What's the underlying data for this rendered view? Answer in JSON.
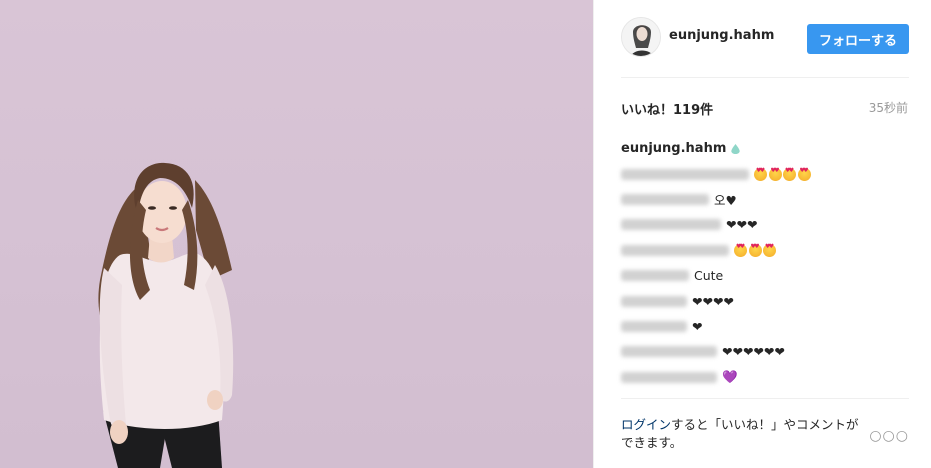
{
  "post": {
    "username": "eunjung.hahm",
    "follow_label": "フォローする",
    "likes_text": "いいね！119件",
    "time_text": "35秒前"
  },
  "caption": {
    "username": "eunjung.hahm",
    "icon": "water-drop-icon"
  },
  "comments": [
    {
      "text": "",
      "emoji": [
        "heart-eyes",
        "heart-eyes",
        "heart-eyes",
        "heart-eyes"
      ]
    },
    {
      "text": "오♥",
      "emoji": []
    },
    {
      "text": "❤❤❤",
      "emoji": []
    },
    {
      "text": "",
      "emoji": [
        "heart-eyes",
        "heart-eyes",
        "heart-eyes"
      ]
    },
    {
      "text": "Cute",
      "emoji": []
    },
    {
      "text": "❤❤❤❤",
      "emoji": []
    },
    {
      "text": "❤",
      "emoji": []
    },
    {
      "text": "❤❤❤❤❤❤",
      "emoji": []
    },
    {
      "text": "💜",
      "emoji": []
    }
  ],
  "footer": {
    "login_link": "ログイン",
    "login_rest": "すると「いいね！」やコメントができます。",
    "more_icon": "more-options-icon"
  },
  "colors": {
    "follow_button": "#3897f0",
    "photo_background": "#d6c2d4",
    "link": "#003569"
  }
}
